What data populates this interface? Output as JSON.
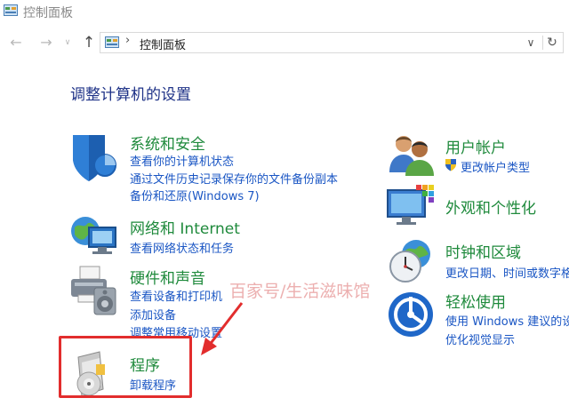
{
  "window": {
    "title": "控制面板"
  },
  "nav": {
    "back_icon": "arrow-left-icon",
    "forward_icon": "arrow-right-icon",
    "recent_icon": "chevron-down-icon",
    "up_icon": "arrow-up-icon",
    "breadcrumb_sep": "›",
    "breadcrumb": "控制面板",
    "dropdown_icon": "chevron-down-icon",
    "refresh_icon": "refresh-icon"
  },
  "heading": "调整计算机的设置",
  "categories": {
    "system": {
      "title": "系统和安全",
      "links": [
        "查看你的计算机状态",
        "通过文件历史记录保存你的文件备份副本",
        "备份和还原(Windows 7)"
      ]
    },
    "network": {
      "title": "网络和 Internet",
      "links": [
        "查看网络状态和任务"
      ]
    },
    "hardware": {
      "title": "硬件和声音",
      "links": [
        "查看设备和打印机",
        "添加设备",
        "调整常用移动设置"
      ]
    },
    "programs": {
      "title": "程序",
      "links": [
        "卸载程序"
      ]
    },
    "users": {
      "title": "用户帐户",
      "links": [
        "更改帐户类型"
      ]
    },
    "appearance": {
      "title": "外观和个性化",
      "links": []
    },
    "clock": {
      "title": "时钟和区域",
      "links": [
        "更改日期、时间或数字格式"
      ]
    },
    "ease": {
      "title": "轻松使用",
      "links": [
        "使用 Windows 建议的设置",
        "优化视觉显示"
      ]
    }
  },
  "watermark": "百家号/生活滋味馆",
  "colors": {
    "category_title": "#1f8a3c",
    "link": "#1a56c4",
    "heading": "#1e3287",
    "highlight": "#e22d2d"
  }
}
